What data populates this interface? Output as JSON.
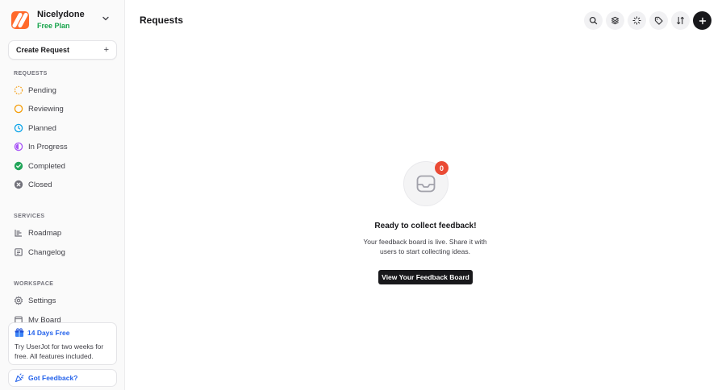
{
  "brand": {
    "name": "Nicelydone",
    "plan": "Free Plan"
  },
  "sidebar": {
    "create_label": "Create Request",
    "requests_label": "REQUESTS",
    "requests": [
      {
        "label": "Pending",
        "icon": "dashed-circle-icon"
      },
      {
        "label": "Reviewing",
        "icon": "circle-icon"
      },
      {
        "label": "Planned",
        "icon": "clock-icon"
      },
      {
        "label": "In Progress",
        "icon": "half-circle-icon"
      },
      {
        "label": "Completed",
        "icon": "check-circle-icon"
      },
      {
        "label": "Closed",
        "icon": "x-circle-icon"
      }
    ],
    "services_label": "SERVICES",
    "services": [
      {
        "label": "Roadmap",
        "icon": "roadmap-icon"
      },
      {
        "label": "Changelog",
        "icon": "changelog-icon"
      }
    ],
    "workspace_label": "WORKSPACE",
    "workspace": [
      {
        "label": "Settings",
        "icon": "gear-icon"
      },
      {
        "label": "My Board",
        "icon": "board-icon"
      }
    ]
  },
  "promo": {
    "title": "14 Days Free",
    "text": "Try UserJot for two weeks for free. All features included."
  },
  "feedback_label": "Got Feedback?",
  "header": {
    "title": "Requests"
  },
  "empty_state": {
    "count": "0",
    "title": "Ready to collect feedback!",
    "description": "Your feedback board is live. Share it with users to start collecting ideas.",
    "button_label": "View Your Feedback Board"
  },
  "colors": {
    "accent_blue": "#2563eb",
    "plan_green": "#16a34a",
    "badge_red": "#ea4b35",
    "logo_orange": "#ff6a2b"
  }
}
